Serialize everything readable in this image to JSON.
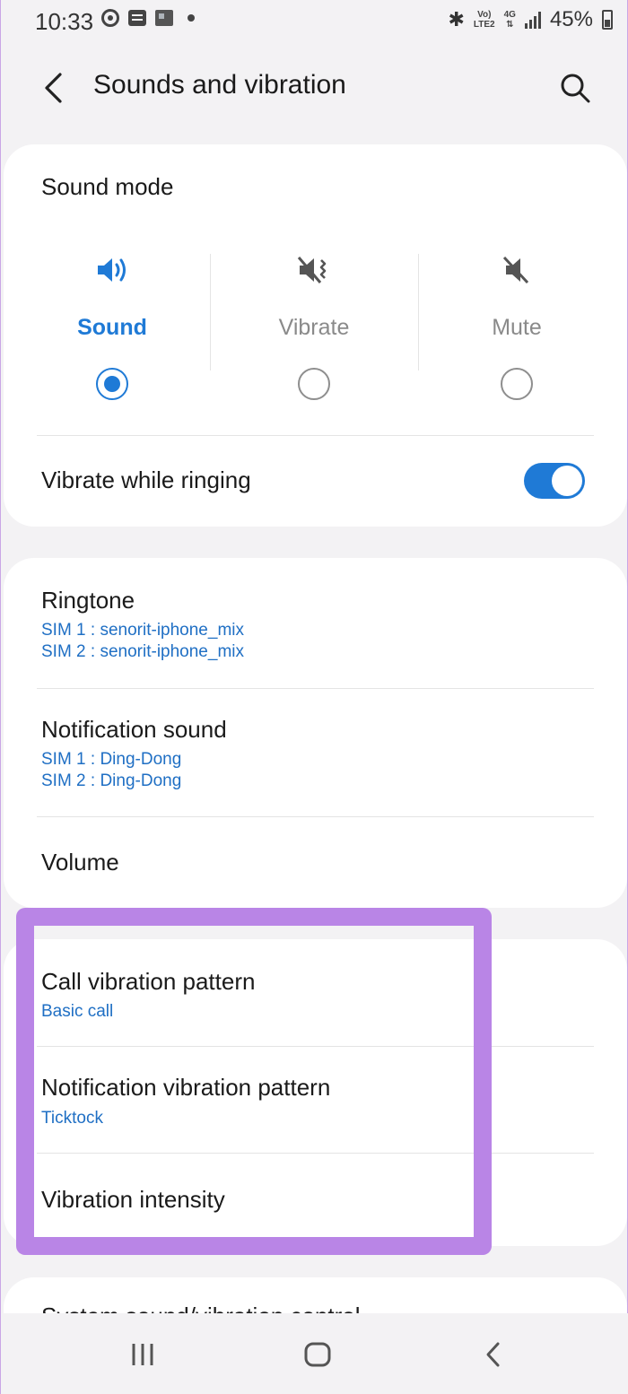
{
  "status": {
    "time": "10:33",
    "network_top": "Vo)",
    "network_bottom": "LTE2",
    "network_type": "4G",
    "battery": "45%"
  },
  "header": {
    "title": "Sounds and vibration"
  },
  "sound_mode": {
    "title": "Sound mode",
    "options": [
      {
        "label": "Sound",
        "selected": true
      },
      {
        "label": "Vibrate",
        "selected": false
      },
      {
        "label": "Mute",
        "selected": false
      }
    ],
    "vibrate_while_ringing": {
      "label": "Vibrate while ringing",
      "on": true
    }
  },
  "sounds": {
    "ringtone": {
      "title": "Ringtone",
      "sim1": "SIM 1 : senorit-iphone_mix",
      "sim2": "SIM 2 : senorit-iphone_mix"
    },
    "notification": {
      "title": "Notification sound",
      "sim1": "SIM 1 : Ding-Dong",
      "sim2": "SIM 2 : Ding-Dong"
    },
    "volume": {
      "title": "Volume"
    }
  },
  "vibration": {
    "call_pattern": {
      "title": "Call vibration pattern",
      "value": "Basic call"
    },
    "notification_pattern": {
      "title": "Notification vibration pattern",
      "value": "Ticktock"
    },
    "intensity": {
      "title": "Vibration intensity"
    }
  },
  "system": {
    "title": "System sound/vibration control"
  },
  "colors": {
    "accent": "#1f7ad6",
    "highlight": "#b985e6",
    "background": "#f3f2f4"
  }
}
